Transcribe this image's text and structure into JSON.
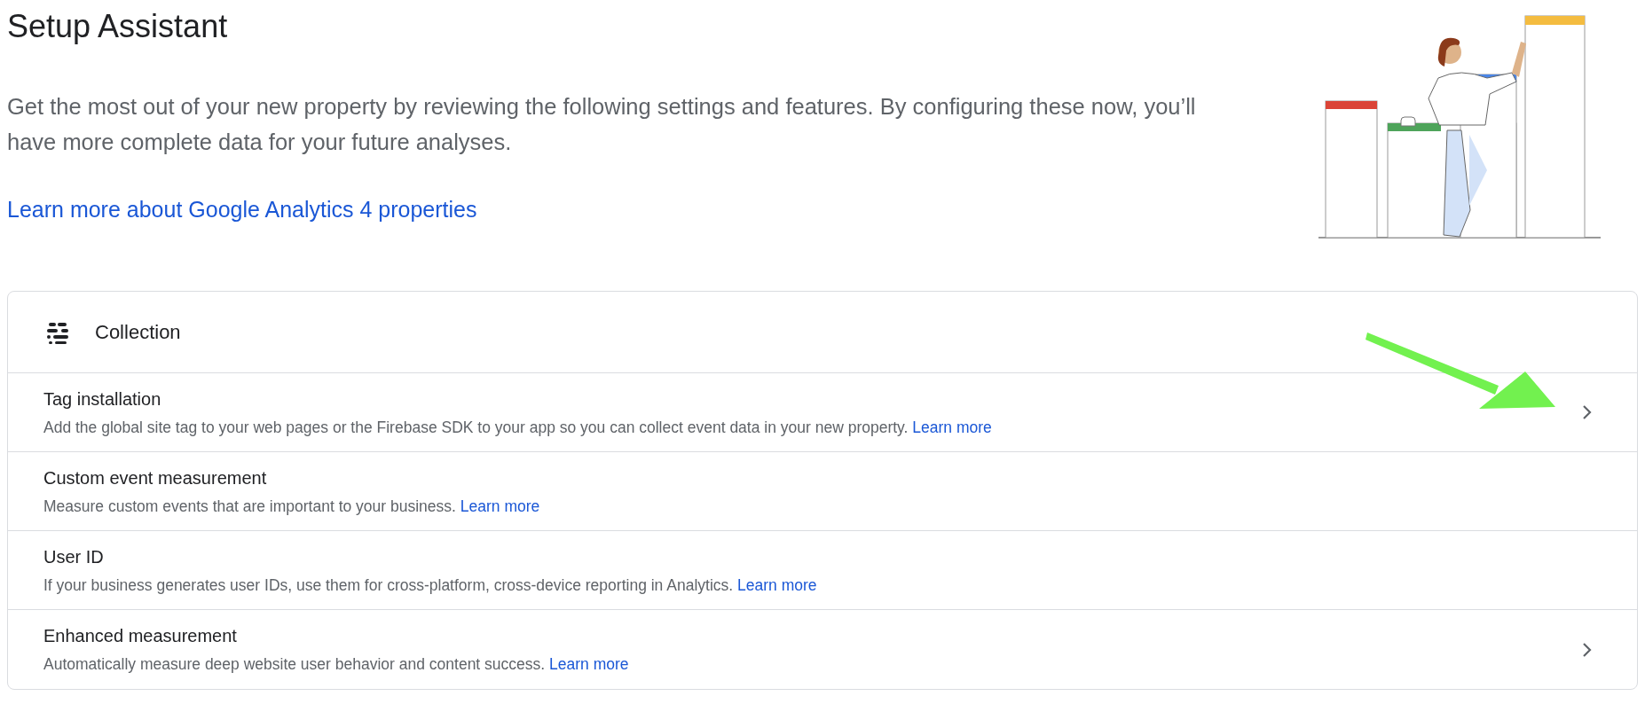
{
  "title": "Setup Assistant",
  "intro": "Get the most out of your new property by reviewing the following settings and features. By configuring these now, you’ll have more complete data for your future analyses.",
  "learn_link": "Learn more about Google Analytics 4 properties",
  "section": {
    "title": "Collection",
    "rows": [
      {
        "title": "Tag installation",
        "description": "Add the global site tag to your web pages or the Firebase SDK to your app so you can collect event data in your new property.",
        "link": "Learn more",
        "chevron": true,
        "annotated": true
      },
      {
        "title": "Custom event measurement",
        "description": "Measure custom events that are important to your business.",
        "link": "Learn more",
        "chevron": false,
        "annotated": false
      },
      {
        "title": "User ID",
        "description": "If your business generates user IDs, use them for cross-platform, cross-device reporting in Analytics.",
        "link": "Learn more",
        "chevron": false,
        "annotated": false
      },
      {
        "title": "Enhanced measurement",
        "description": "Automatically measure deep website user behavior and content success.",
        "link": "Learn more",
        "chevron": true,
        "annotated": false
      }
    ]
  }
}
